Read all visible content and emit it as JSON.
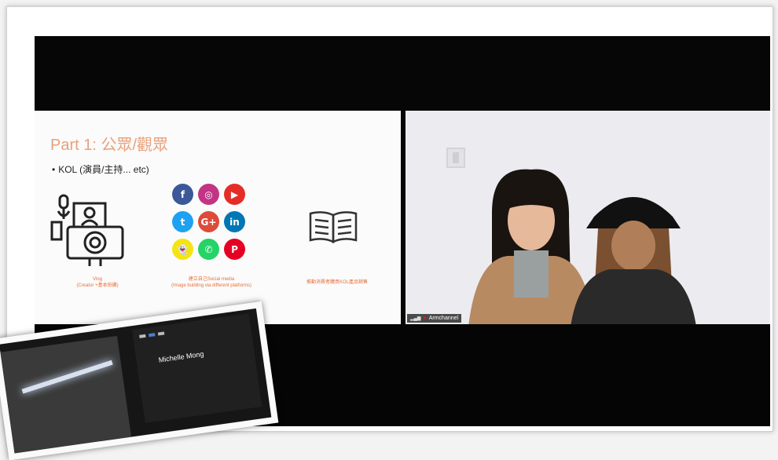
{
  "slide": {
    "title": "Part 1: 公眾/觀眾",
    "bullet": "KOL (演員/主持... etc)",
    "captions": {
      "vlog": "Vlog\n(Creator +基本拍攝)",
      "social": "建立自己Social media\n(Image building via different platforms)",
      "book": "推動消費者購買KOL產品銷售"
    },
    "social_icons": [
      {
        "name": "facebook-icon",
        "glyph": "f",
        "color": "#3b5998"
      },
      {
        "name": "instagram-icon",
        "glyph": "◎",
        "color": "#c13584"
      },
      {
        "name": "youtube-icon",
        "glyph": "▶",
        "color": "#e52d27"
      },
      {
        "name": "twitter-icon",
        "glyph": "t",
        "color": "#1da1f2"
      },
      {
        "name": "google-plus-icon",
        "glyph": "G+",
        "color": "#dd4b39"
      },
      {
        "name": "linkedin-icon",
        "glyph": "in",
        "color": "#0077b5"
      },
      {
        "name": "snapchat-icon",
        "glyph": "👻",
        "color": "#f5e414"
      },
      {
        "name": "whatsapp-icon",
        "glyph": "✆",
        "color": "#25d366"
      },
      {
        "name": "pinterest-icon",
        "glyph": "P",
        "color": "#e60023"
      }
    ]
  },
  "video": {
    "participant_name": "Armchannel"
  },
  "inset": {
    "participant_name": "Michelle Mong"
  },
  "colors": {
    "slide_title": "#e8a07a",
    "caption": "#e8703a",
    "screen_bg": "#050505"
  }
}
